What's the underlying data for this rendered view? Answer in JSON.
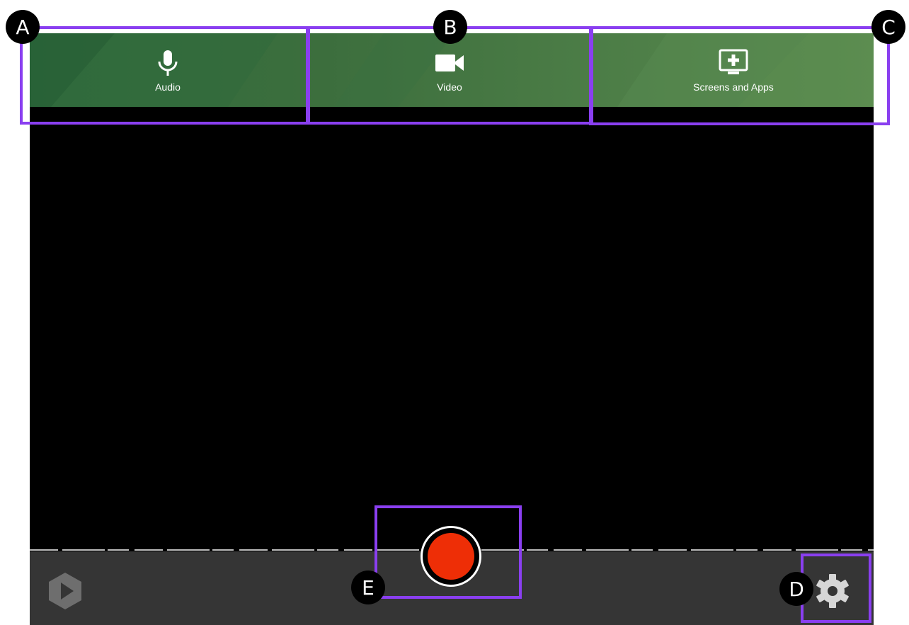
{
  "sources": {
    "tabs": [
      {
        "label": "Audio",
        "icon": "microphone-icon"
      },
      {
        "label": "Video",
        "icon": "video-camera-icon"
      },
      {
        "label": "Screens and Apps",
        "icon": "add-screen-icon"
      }
    ]
  },
  "toolbar": {
    "logo_icon": "panopto-logo",
    "record_icon": "record-icon",
    "settings_icon": "gear-icon"
  },
  "annotations": {
    "labels": [
      "A",
      "B",
      "C",
      "D",
      "E"
    ]
  },
  "colors": {
    "accent_green": "#3c6e3d",
    "record_red": "#ee2e06",
    "toolbar_bg": "#353535",
    "annotation_purple": "#8a3ff0"
  }
}
